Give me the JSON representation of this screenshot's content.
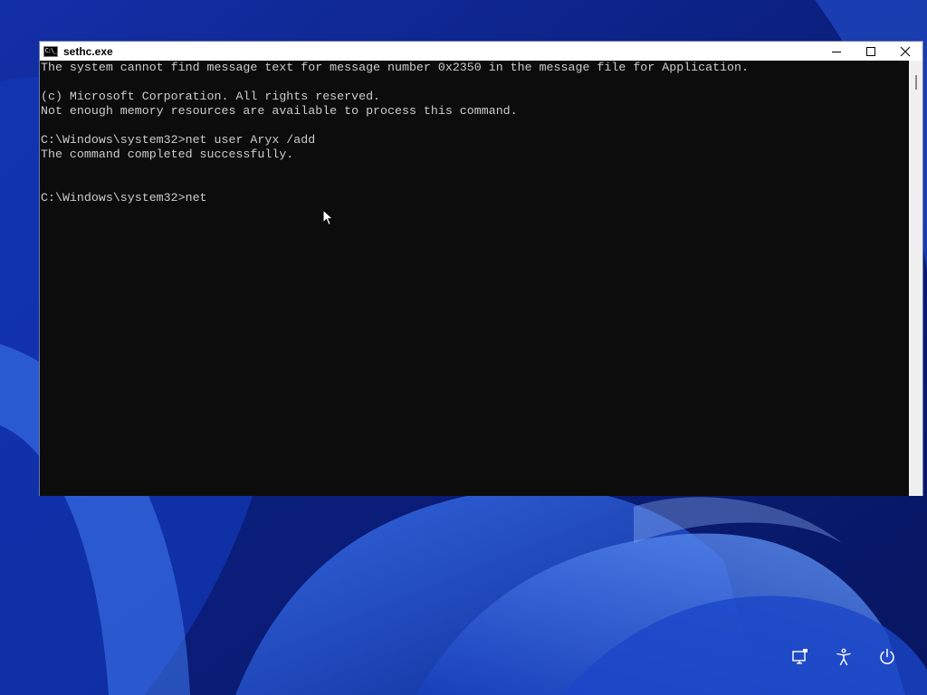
{
  "window": {
    "title": "sethc.exe",
    "icon": "console-app-icon",
    "icon_glyph": "C:\\_",
    "buttons": {
      "minimize": "minimize-icon",
      "maximize": "maximize-icon",
      "close": "close-icon"
    }
  },
  "console": {
    "background": "#0c0c0c",
    "text_color": "#cccccc",
    "lines": [
      "The system cannot find message text for message number 0x2350 in the message file for Application.",
      "",
      "(c) Microsoft Corporation. All rights reserved.",
      "Not enough memory resources are available to process this command.",
      "",
      "C:\\Windows\\system32>net user Aryx /add",
      "The command completed successfully.",
      "",
      "",
      "C:\\Windows\\system32>net"
    ]
  },
  "lock_screen": {
    "icons": [
      "network-icon",
      "accessibility-icon",
      "power-icon"
    ],
    "wallpaper_colors": [
      "#0a1f7a",
      "#1e4fd8",
      "#5a8cf0"
    ]
  }
}
